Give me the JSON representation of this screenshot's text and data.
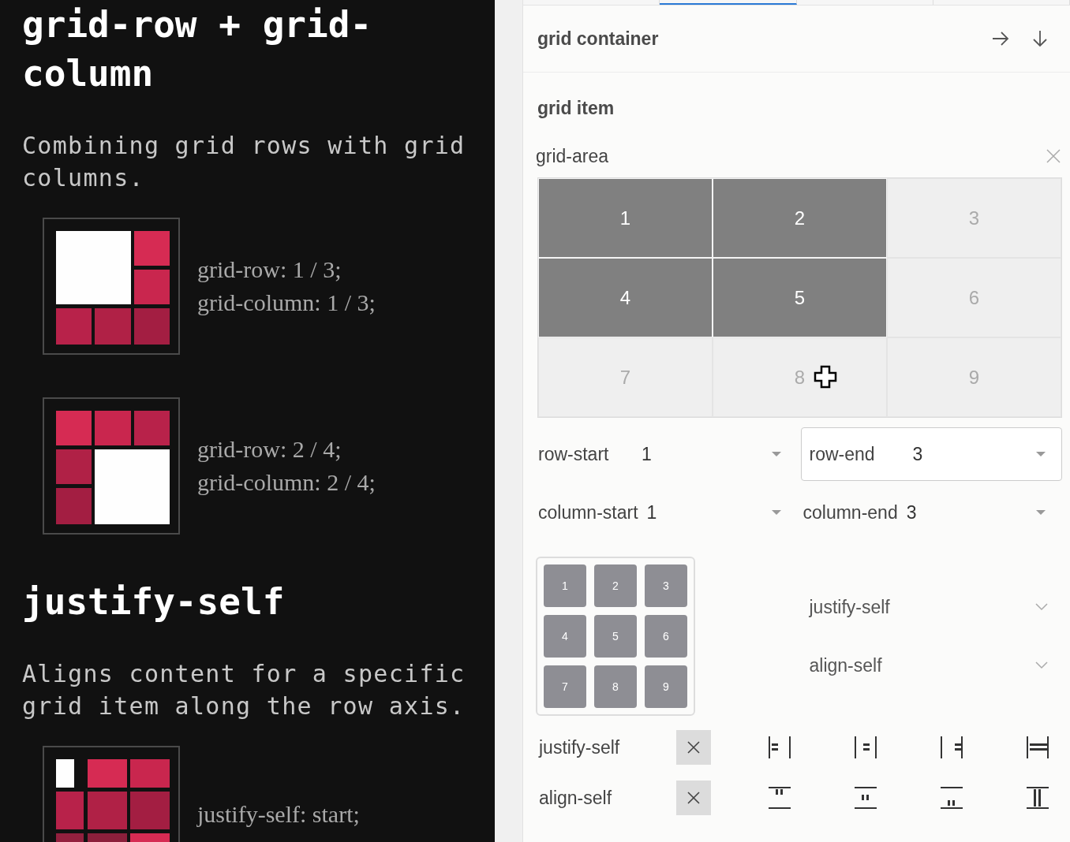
{
  "guide": {
    "sections": [
      {
        "title": "grid-row + grid-column",
        "description": "Combining grid rows with grid columns.",
        "examples": [
          {
            "kind": "area-top-left",
            "lines": [
              "grid-row: 1 / 3;",
              "grid-column: 1 / 3;"
            ]
          },
          {
            "kind": "area-bottom-right",
            "lines": [
              "grid-row: 2 / 4;",
              "grid-column: 2 / 4;"
            ]
          }
        ]
      },
      {
        "title": "justify-self",
        "description": "Aligns content for a specific grid item along the row axis.",
        "examples": [
          {
            "kind": "justify-start",
            "lines": [
              "justify-self: start;"
            ]
          }
        ]
      }
    ]
  },
  "panel": {
    "tabs": [
      {
        "selected": false
      },
      {
        "selected": true
      },
      {
        "selected": false
      },
      {
        "selected": false
      }
    ],
    "container_header": {
      "title": "grid container"
    },
    "item_section": {
      "title": "grid item",
      "grid_area": {
        "label": "grid-area",
        "cells": [
          {
            "label": "1",
            "selected": true,
            "hovered": false
          },
          {
            "label": "2",
            "selected": true,
            "hovered": false
          },
          {
            "label": "3",
            "selected": false,
            "hovered": false
          },
          {
            "label": "4",
            "selected": true,
            "hovered": false
          },
          {
            "label": "5",
            "selected": true,
            "hovered": false
          },
          {
            "label": "6",
            "selected": false,
            "hovered": false
          },
          {
            "label": "7",
            "selected": false,
            "hovered": false
          },
          {
            "label": "8",
            "selected": false,
            "hovered": true
          },
          {
            "label": "9",
            "selected": false,
            "hovered": false
          }
        ]
      },
      "fields": [
        {
          "label": "row-start",
          "value": "1",
          "focused": false
        },
        {
          "label": "row-end",
          "value": "3",
          "focused": true
        },
        {
          "label": "column-start",
          "value": "1",
          "focused": false
        },
        {
          "label": "column-end",
          "value": "3",
          "focused": false
        }
      ],
      "placement_grid": [
        "1",
        "2",
        "3",
        "4",
        "5",
        "6",
        "7",
        "8",
        "9"
      ],
      "dropdowns": [
        {
          "placeholder": "justify-self"
        },
        {
          "placeholder": "align-self"
        }
      ],
      "alignment_rows": [
        {
          "label": "justify-self",
          "kind": "row",
          "options": [
            {
              "kind": "start"
            },
            {
              "kind": "center"
            },
            {
              "kind": "end"
            },
            {
              "kind": "stretch"
            }
          ]
        },
        {
          "label": "align-self",
          "kind": "column",
          "options": [
            {
              "kind": "start"
            },
            {
              "kind": "center"
            },
            {
              "kind": "end"
            },
            {
              "kind": "stretch"
            }
          ]
        }
      ]
    }
  }
}
